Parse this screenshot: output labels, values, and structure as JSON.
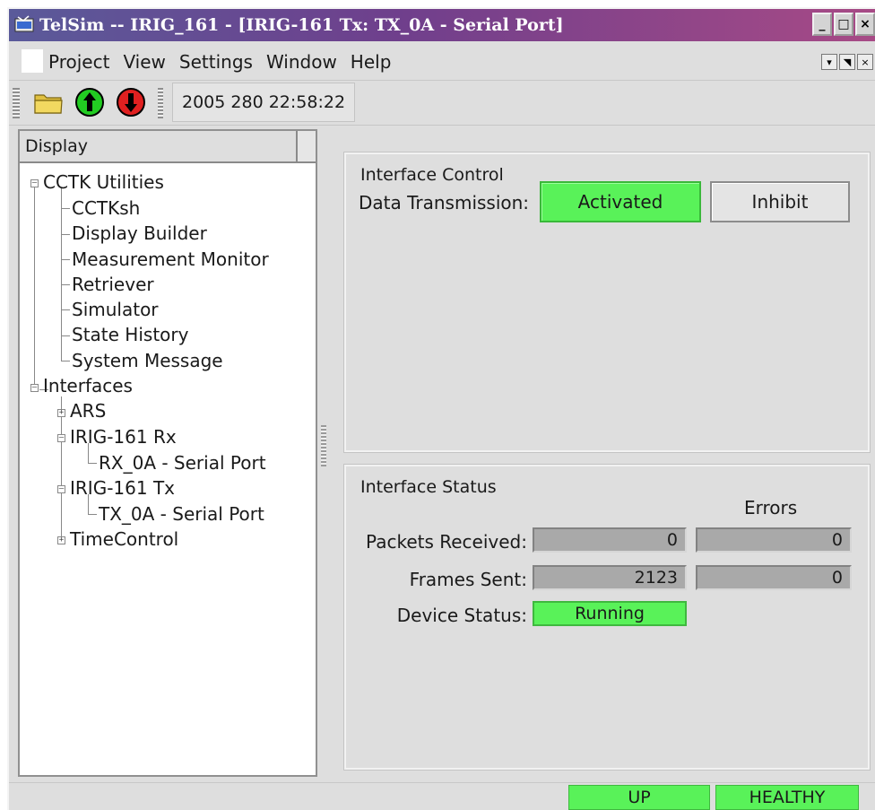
{
  "window": {
    "title": "TelSim -- IRIG_161 - [IRIG-161 Tx: TX_0A - Serial Port]",
    "controls": [
      "_",
      "□",
      "×"
    ]
  },
  "menubar": {
    "items": [
      "Project",
      "View",
      "Settings",
      "Window",
      "Help"
    ],
    "mdi_controls": [
      "▾",
      "◥",
      "×"
    ]
  },
  "toolbar": {
    "icons": [
      "open-folder-icon",
      "upload-arrow-icon",
      "download-arrow-icon"
    ],
    "timestamp": "2005 280 22:58:22"
  },
  "tree": {
    "header": "Display",
    "nodes": {
      "cctk_utilities": "CCTK Utilities",
      "cctksh": "CCTKsh",
      "display_builder": "Display Builder",
      "measurement_monitor": "Measurement Monitor",
      "retriever": "Retriever",
      "simulator": "Simulator",
      "state_history": "State History",
      "system_message": "System Message",
      "interfaces": "Interfaces",
      "ars": "ARS",
      "irig_rx": "IRIG-161 Rx",
      "rx_0a": "RX_0A - Serial Port",
      "irig_tx": "IRIG-161 Tx",
      "tx_0a": "TX_0A - Serial Port",
      "time_control": "TimeControl"
    }
  },
  "interface_control": {
    "title": "Interface Control",
    "data_transmission_label": "Data Transmission:",
    "activated_label": "Activated",
    "inhibit_label": "Inhibit"
  },
  "interface_status": {
    "title": "Interface Status",
    "errors_header": "Errors",
    "packets_received_label": "Packets Received:",
    "packets_received_value": "0",
    "packets_received_errors": "0",
    "frames_sent_label": "Frames Sent:",
    "frames_sent_value": "2123",
    "frames_sent_errors": "0",
    "device_status_label": "Device Status:",
    "device_status_value": "Running"
  },
  "statusbar": {
    "link": "UP",
    "health": "HEALTHY"
  },
  "colors": {
    "active_green": "#59f259",
    "title_gradient_start": "#5a5a9a",
    "title_gradient_end": "#a74a86"
  }
}
